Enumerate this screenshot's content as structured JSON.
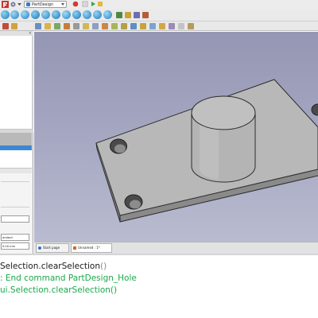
{
  "toolbar": {
    "workbench": "PartDesign"
  },
  "model_panel": {
    "close_label": "×"
  },
  "task_panel": {
    "field_1": "",
    "field_2": "andard",
    "field_3": "0.00 mm",
    "label_1": "",
    "label_2": ""
  },
  "doc_tabs": {
    "start": "Start page",
    "document": "Unnamed : 1*"
  },
  "console": {
    "line1_text": "Selection.clearSelection",
    "line1_parens": "()",
    "line2": ": End command PartDesign_Hole",
    "line3": "ui.Selection.clearSelection()"
  },
  "colors": {
    "view_bg_top": "#9496b3",
    "view_bg_bottom": "#b9bbd0",
    "model_face": "#b8b8b8",
    "console_green": "#19a84a",
    "selection_blue": "#3d87d6"
  }
}
